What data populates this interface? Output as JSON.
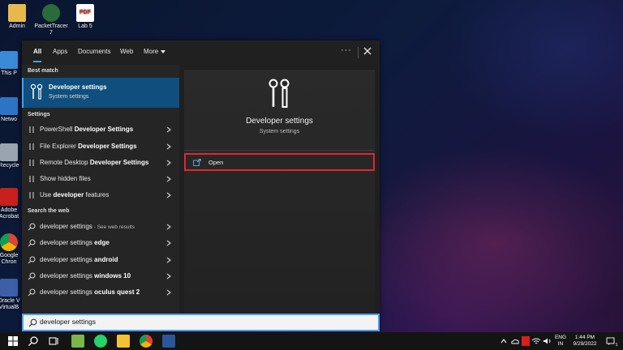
{
  "desktop": {
    "icons_top": [
      {
        "label": "Admin"
      },
      {
        "label": "PacketTracer\n7"
      },
      {
        "label": "Lab 5"
      }
    ],
    "icons_left": [
      {
        "label": "This P"
      },
      {
        "label": "Netwo"
      },
      {
        "label": "Recycle"
      },
      {
        "label": "Adobe\nAcrobat"
      },
      {
        "label": "Google\nChron"
      },
      {
        "label": "Oracle V\nVirtualB"
      }
    ]
  },
  "search_panel": {
    "tabs": [
      "All",
      "Apps",
      "Documents",
      "Web",
      "More"
    ],
    "active_tab": "All",
    "best_match_header": "Best match",
    "best_match": {
      "title": "Developer settings",
      "subtitle": "System settings"
    },
    "settings_header": "Settings",
    "settings_items": [
      {
        "plain": "PowerShell ",
        "bold": "Developer Settings"
      },
      {
        "plain": "File Explorer ",
        "bold": "Developer Settings"
      },
      {
        "plain": "Remote Desktop ",
        "bold": "Developer Settings"
      },
      {
        "plain": "Show hidden files",
        "bold": ""
      },
      {
        "plain": "Use ",
        "bold": "developer",
        "tail": " features"
      }
    ],
    "web_header": "Search the web",
    "web_items": [
      {
        "plain": "developer settings",
        "sub": " - See web results",
        "bold": ""
      },
      {
        "plain": "developer settings ",
        "bold": "edge"
      },
      {
        "plain": "developer settings ",
        "bold": "android"
      },
      {
        "plain": "developer settings ",
        "bold": "windows 10"
      },
      {
        "plain": "developer settings ",
        "bold": "oculus quest 2"
      }
    ],
    "preview": {
      "title": "Developer settings",
      "subtitle": "System settings",
      "open_label": "Open"
    },
    "search_value": "developer settings"
  },
  "taskbar": {
    "lang_top": "ENG",
    "lang_bottom": "IN",
    "time": "1:44 PM",
    "date": "9/29/2022",
    "notification_count": "1"
  },
  "colors": {
    "accent": "#4aa0f0",
    "selection": "#0f4e7d",
    "highlight_border": "#e0282e"
  }
}
